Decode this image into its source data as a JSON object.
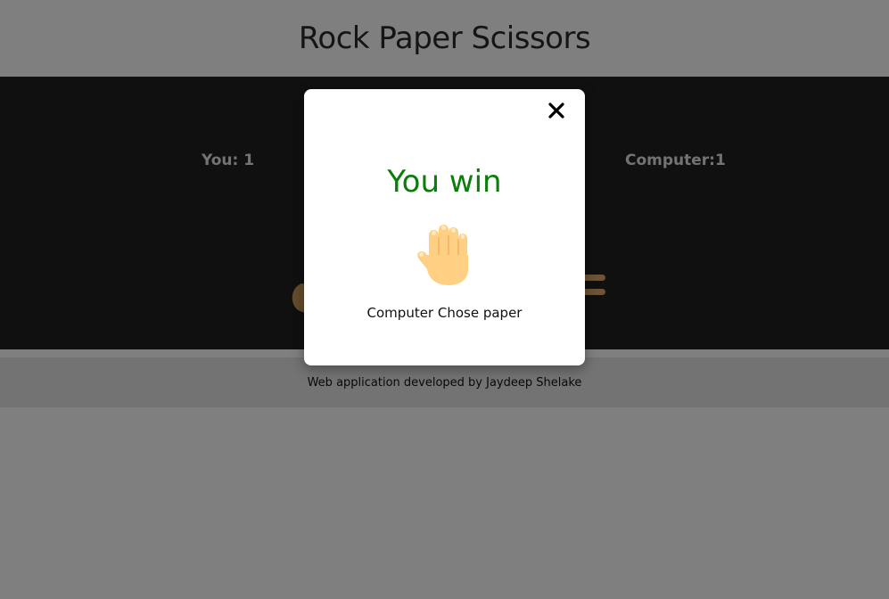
{
  "header": {
    "title": "Rock Paper Scissors"
  },
  "scoreboard": {
    "you_label": "You: 1",
    "computer_label": "Computer:1"
  },
  "footer": {
    "credit": "Web application developed by Jaydeep Shelake"
  },
  "modal": {
    "result": "You win",
    "computer_choice_text": "Computer Chose paper",
    "choice_icon": "raised-hand-icon",
    "close_icon": "close-icon"
  },
  "colors": {
    "win_text": "#0a7d0a",
    "board_bg": "#212121",
    "overlay": "rgba(0,0,0,0.5)"
  }
}
